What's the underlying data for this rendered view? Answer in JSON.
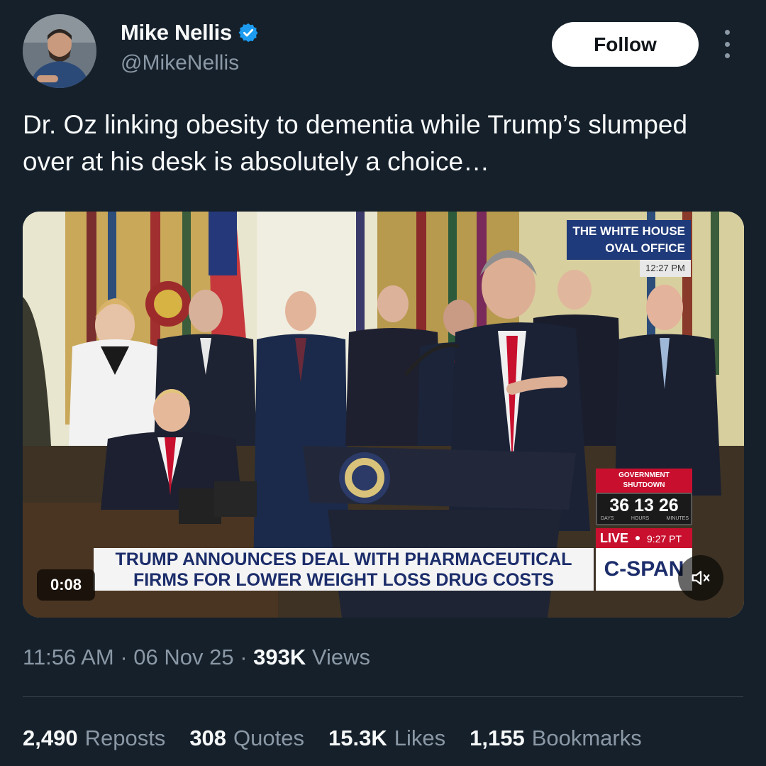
{
  "author": {
    "name": "Mike Nellis",
    "handle": "@MikeNellis",
    "verified": true,
    "avatar_icon": "person-photo"
  },
  "actions": {
    "follow_label": "Follow",
    "more_icon": "vertical-ellipsis-icon"
  },
  "tweet": {
    "text": "Dr. Oz linking obesity to dementia while Trump’s slumped over at his desk is absolutely a choice…"
  },
  "video": {
    "elapsed": "0:08",
    "muted": true,
    "overlay": {
      "location_line1": "THE WHITE HOUSE",
      "location_line2": "OVAL OFFICE",
      "location_time": "12:27 PM",
      "shutdown_line1": "GOVERNMENT",
      "shutdown_line2": "SHUTDOWN",
      "shutdown_counter": "36 13 26",
      "shutdown_units": [
        "DAYS",
        "HOURS",
        "MINUTES"
      ],
      "live_label": "LIVE",
      "live_time": "9:27 PT",
      "headline_line1": "TRUMP ANNOUNCES DEAL WITH PHARMACEUTICAL",
      "headline_line2": "FIRMS FOR LOWER WEIGHT LOSS DRUG COSTS",
      "network": "C-SPAN"
    }
  },
  "meta": {
    "time": "11:56 AM",
    "date": "06 Nov 25",
    "views_count": "393K",
    "views_label": "Views"
  },
  "stats": [
    {
      "count": "2,490",
      "label": "Reposts"
    },
    {
      "count": "308",
      "label": "Quotes"
    },
    {
      "count": "15.3K",
      "label": "Likes"
    },
    {
      "count": "1,155",
      "label": "Bookmarks"
    }
  ],
  "colors": {
    "background": "#15202b",
    "primary_text": "#f7f9f9",
    "secondary_text": "#8b98a5",
    "verified_blue": "#1d9bf0",
    "divider": "#38444d"
  }
}
